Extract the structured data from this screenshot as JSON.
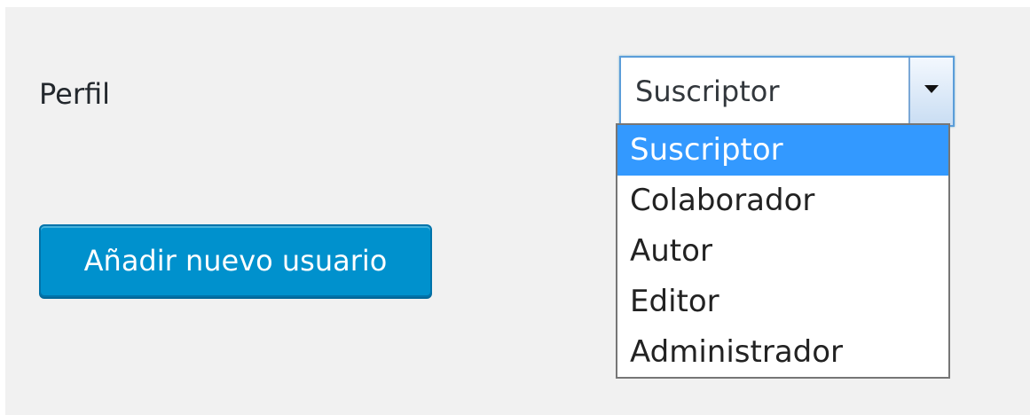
{
  "form": {
    "profile_label": "Perfil",
    "role_select": {
      "selected": "Suscriptor",
      "options": [
        "Suscriptor",
        "Colaborador",
        "Autor",
        "Editor",
        "Administrador"
      ],
      "highlighted_index": 0
    },
    "add_user_button": "Añadir nuevo usuario"
  },
  "icons": {
    "select_arrow": "chevron-down-icon"
  },
  "colors": {
    "panel_bg": "#f1f1f1",
    "button_bg": "#0091cd",
    "option_highlight": "#3399ff",
    "focus_border": "#5b9dd9"
  }
}
